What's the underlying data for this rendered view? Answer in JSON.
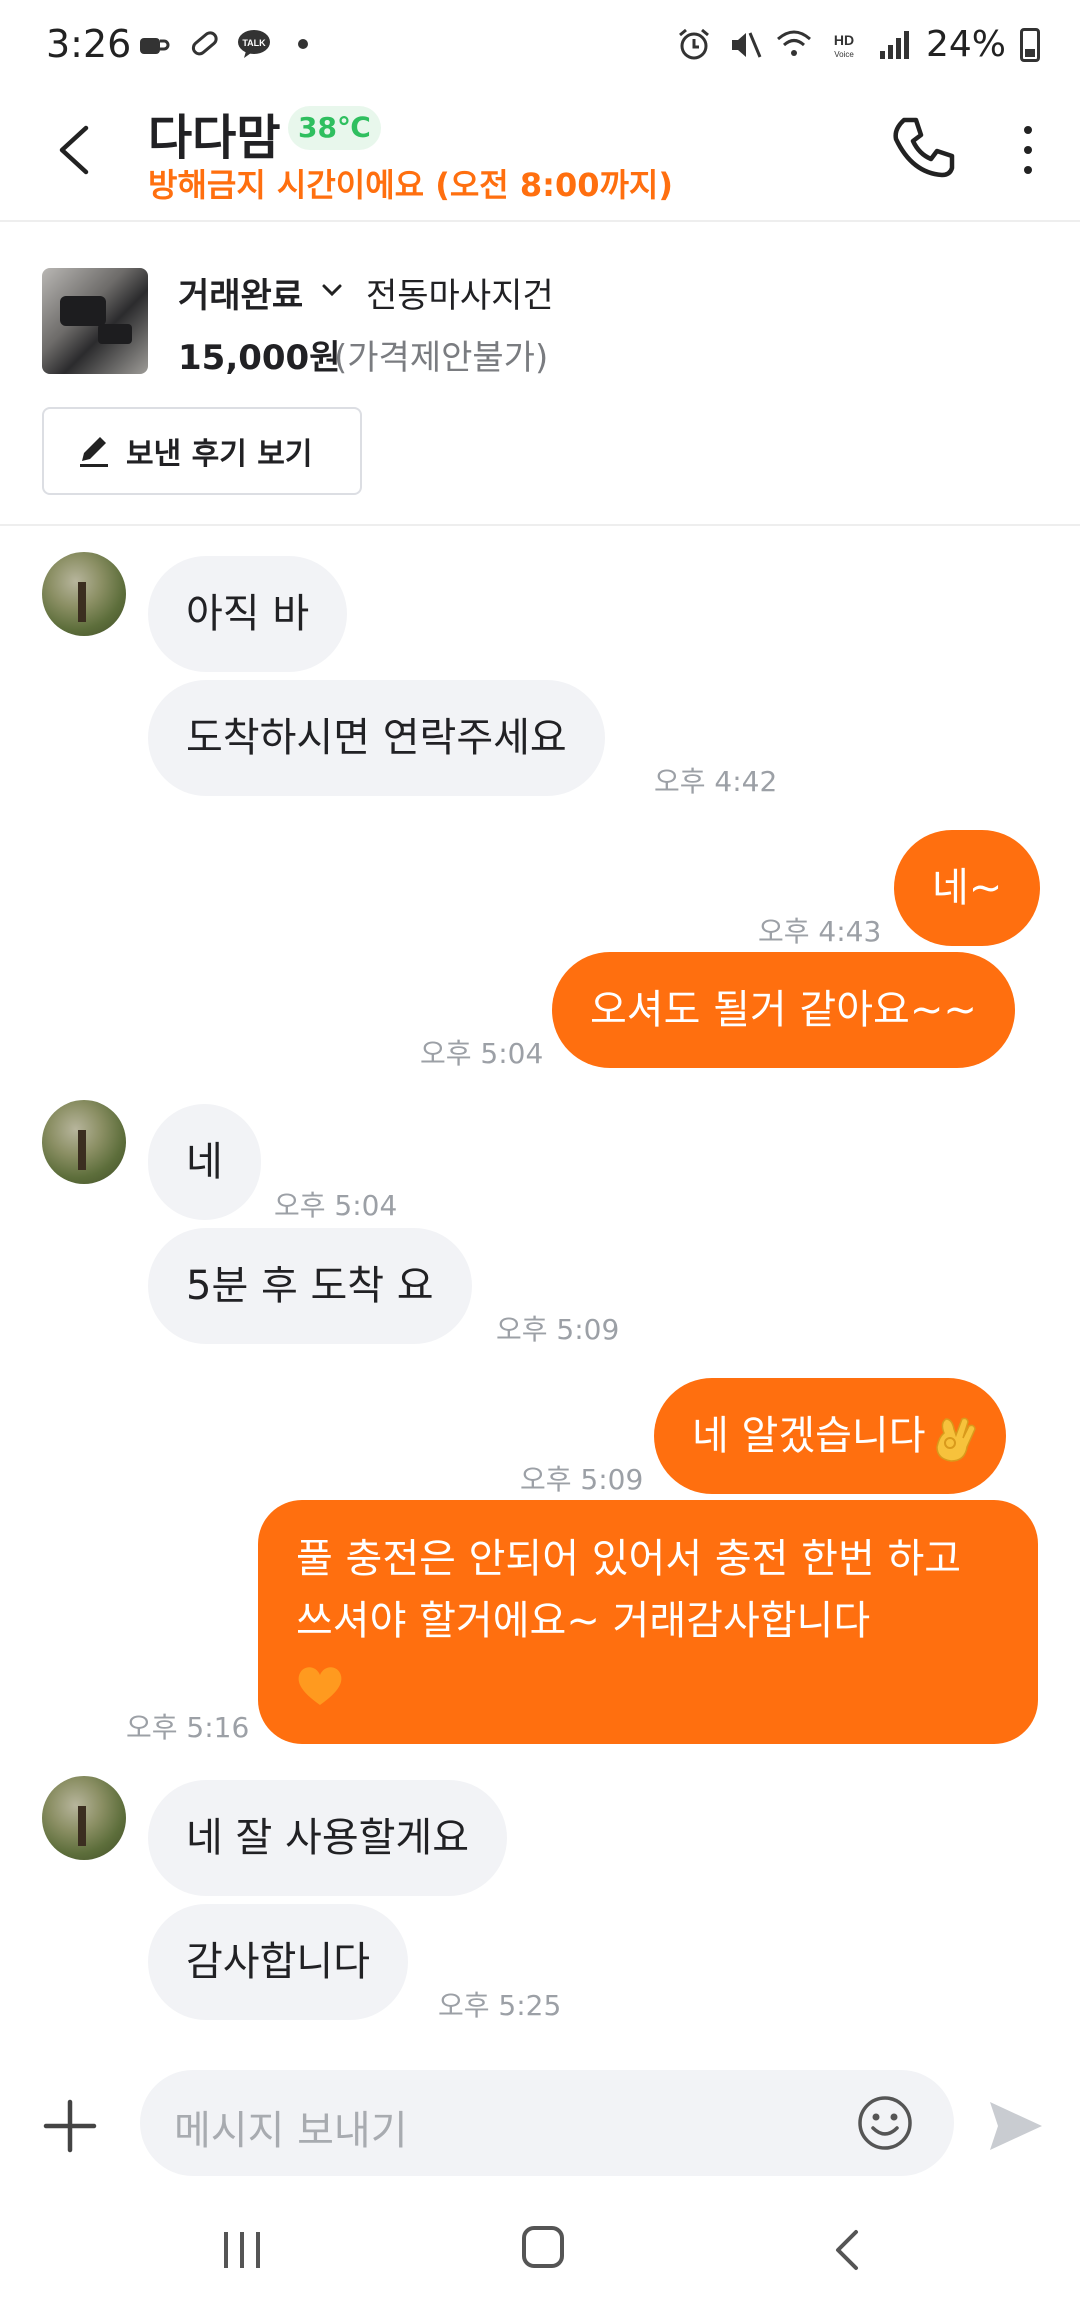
{
  "status_bar": {
    "time": "3:26",
    "battery": "24%"
  },
  "header": {
    "nickname": "다다맘",
    "temperature": "38℃",
    "dnd_notice": "방해금지 시간이에요 (오전 8:00까지)"
  },
  "product": {
    "status": "거래완료",
    "title": "전동마사지건",
    "price": "15,000원",
    "price_note": "(가격제안불가)",
    "review_button": "보낸 후기 보기"
  },
  "messages": [
    {
      "side": "in",
      "text": "아직 바",
      "time": ""
    },
    {
      "side": "in",
      "text": "도착하시면 연락주세요",
      "time": "오후 4:42"
    },
    {
      "side": "out",
      "text": "네~",
      "time": "오후 4:43"
    },
    {
      "side": "out",
      "text": "오셔도 될거 같아요~~",
      "time": "오후 5:04"
    },
    {
      "side": "in",
      "text": "네",
      "time": "오후 5:04"
    },
    {
      "side": "in",
      "text": "5분 후 도착 요",
      "time": "오후 5:09"
    },
    {
      "side": "out",
      "text": "네 알겠습니다",
      "time": "오후 5:09"
    },
    {
      "side": "out",
      "text": "풀 충전은 안되어 있어서 충전 한번 하고 쓰셔야 할거에요~ 거래감사합니다",
      "time": "오후 5:16"
    },
    {
      "side": "in",
      "text": "네 잘 사용할게요",
      "time": ""
    },
    {
      "side": "in",
      "text": "감사합니다",
      "time": "오후 5:25"
    }
  ],
  "input": {
    "placeholder": "메시지 보내기"
  },
  "colors": {
    "accent": "#ff6f0f",
    "incoming_bubble": "#f2f3f6",
    "temperature": "#2fbf5f"
  },
  "icons": [
    "back-icon",
    "phone-icon",
    "more-vertical-icon",
    "chevron-down-icon",
    "pencil-icon",
    "plus-icon",
    "smile-icon",
    "send-icon",
    "ok-hand-emoji",
    "orange-heart-emoji"
  ]
}
